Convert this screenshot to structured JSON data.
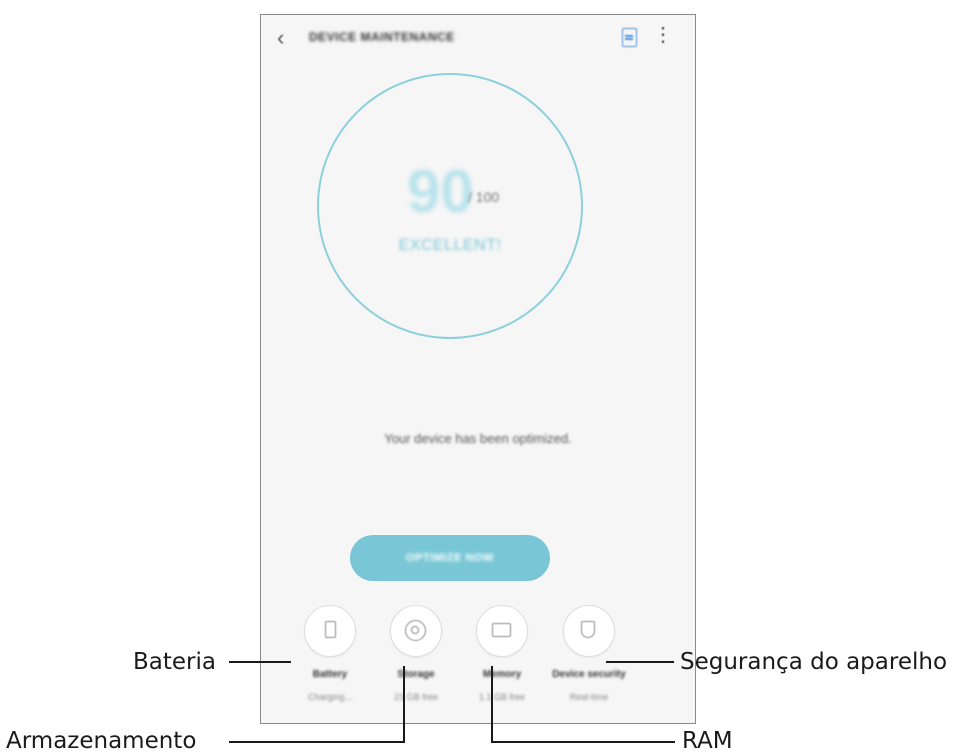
{
  "header": {
    "back_icon": "chevron-left-icon",
    "title": "DEVICE MAINTENANCE",
    "report_icon": "document-icon",
    "more_icon": "more-vertical-icon"
  },
  "score": {
    "value": "90",
    "max": "/ 100",
    "label": "EXCELLENT!"
  },
  "status_text": "Your device has been optimized.",
  "fix_button": "OPTIMIZE NOW",
  "features": [
    {
      "name": "Battery",
      "sub": "Charging...",
      "icon": "battery-icon"
    },
    {
      "name": "Storage",
      "sub": "21 GB free",
      "icon": "storage-icon"
    },
    {
      "name": "Memory",
      "sub": "1.1 GB free",
      "icon": "memory-icon"
    },
    {
      "name": "Device security",
      "sub": "Real-time",
      "icon": "shield-icon"
    }
  ],
  "callouts": {
    "battery": "Bateria",
    "storage": "Armazenamento",
    "ram": "RAM",
    "security": "Segurança do aparelho"
  },
  "colors": {
    "accent": "#79c7d6",
    "ring": "#8cd0dd",
    "background": "#f6f6f6"
  }
}
